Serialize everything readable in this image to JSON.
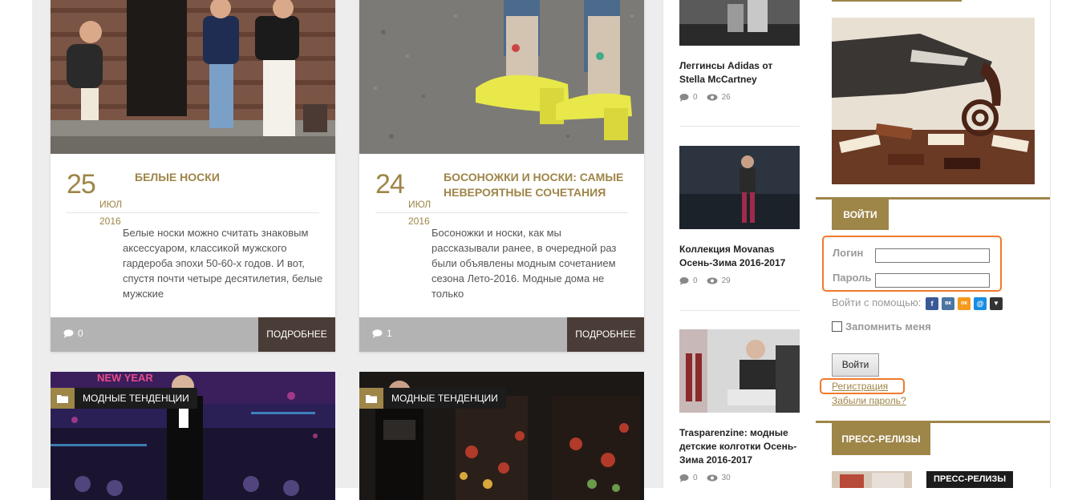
{
  "posts": [
    {
      "day": "25",
      "month": "ИЮЛ",
      "year": "2016",
      "title": "БЕЛЫЕ НОСКИ",
      "excerpt": "Белые носки можно считать знаковым аксессуаром, классикой мужского гардероба эпохи 50-60-х годов. И вот, спустя почти четыре десятилетия, белые мужские",
      "comments": "0",
      "more_label": "ПОДРОБНЕЕ"
    },
    {
      "day": "24",
      "month": "ИЮЛ",
      "year": "2016",
      "title": "БОСОНОЖКИ И НОСКИ: САМЫЕ НЕВЕРОЯТНЫЕ СОЧЕТАНИЯ",
      "excerpt": "Босоножки и носки, как мы рассказывали ранее, в очередной раз были объявлены модным сочетанием сезона Лето-2016. Модные дома не только",
      "comments": "1",
      "more_label": "ПОДРОБНЕЕ"
    }
  ],
  "posts_row2": [
    {
      "category": "МОДНЫЕ ТЕНДЕНЦИИ",
      "banner": "NEW YEAR"
    },
    {
      "category": "МОДНЫЕ ТЕНДЕНЦИИ"
    }
  ],
  "mini_articles": [
    {
      "title": "Леггинсы Adidas от Stella McCartney",
      "comments": "0",
      "views": "26"
    },
    {
      "title": "Коллекция Movanas Осень-Зима 2016-2017",
      "comments": "0",
      "views": "29"
    },
    {
      "title": "Trasparenzine: модные детские колготки Осень-Зима 2016-2017",
      "comments": "0",
      "views": "30"
    }
  ],
  "login": {
    "header": "ВОЙТИ",
    "login_label": "Логин",
    "password_label": "Пароль",
    "login_value": "",
    "password_value": "",
    "social_label": "Войти с помощью:",
    "social": [
      "f",
      "вк",
      "ок",
      "@",
      "▼"
    ],
    "remember_label": "Запомнить меня",
    "submit_label": "Войти",
    "register_link": "Регистрация",
    "forgot_link": "Забыли пароль?"
  },
  "press": {
    "header": "ПРЕСС-РЕЛИЗЫ",
    "badge": "ПРЕСС-РЕЛИЗЫ"
  },
  "colors": {
    "accent": "#9e8548",
    "button_dark": "#4a3c36",
    "highlight": "#f07a2c"
  }
}
